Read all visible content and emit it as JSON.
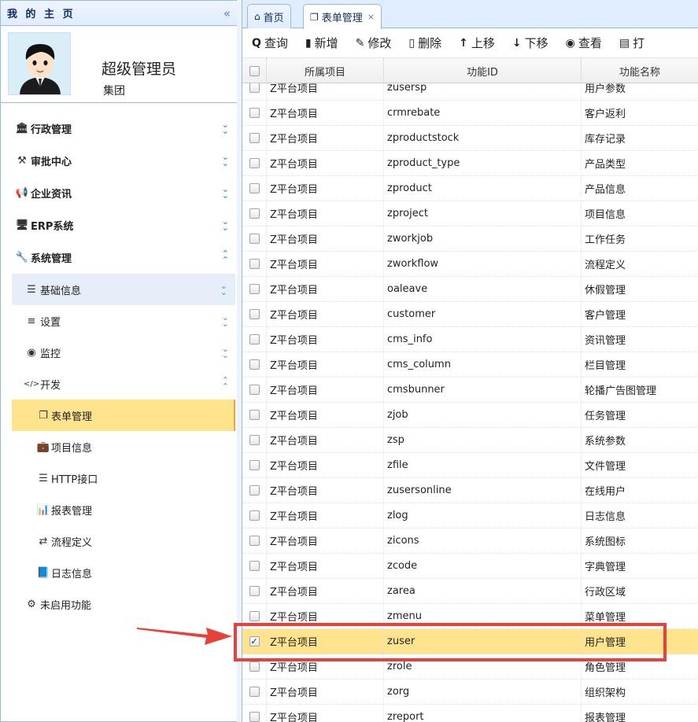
{
  "sidebar": {
    "title": "我 的 主 页",
    "collapse_icon": "double-chevron-left-icon",
    "profile": {
      "name": "超级管理员",
      "org": "集团"
    },
    "menus": [
      {
        "icon": "bank-icon",
        "glyph": "🏛",
        "label": "行政管理",
        "chevron": "expand"
      },
      {
        "icon": "gavel-icon",
        "glyph": "⚒",
        "label": "审批中心",
        "chevron": "expand"
      },
      {
        "icon": "bullhorn-icon",
        "glyph": "📢",
        "label": "企业资讯",
        "chevron": "expand"
      },
      {
        "icon": "monitor-icon",
        "glyph": "🖥",
        "label": "ERP系统",
        "chevron": "expand"
      },
      {
        "icon": "wrench-icon",
        "glyph": "🔧",
        "label": "系统管理",
        "chevron": "collapse"
      }
    ],
    "submenus": [
      {
        "icon": "bars-icon",
        "glyph": "☰",
        "label": "基础信息",
        "chevron": "expand",
        "highlight": true
      },
      {
        "icon": "sliders-icon",
        "glyph": "≡",
        "label": "设置",
        "chevron": "expand"
      },
      {
        "icon": "dashboard-icon",
        "glyph": "◉",
        "label": "监控",
        "chevron": "expand"
      },
      {
        "icon": "code-icon",
        "glyph": "</>",
        "label": "开发",
        "chevron": "collapse"
      }
    ],
    "leaves": [
      {
        "icon": "windows-restore-icon",
        "glyph": "❐",
        "label": "表单管理",
        "active": true
      },
      {
        "icon": "briefcase-icon",
        "glyph": "💼",
        "label": "项目信息"
      },
      {
        "icon": "server-icon",
        "glyph": "☰",
        "label": "HTTP接口"
      },
      {
        "icon": "bar-chart-icon",
        "glyph": "📊",
        "label": "报表管理"
      },
      {
        "icon": "usb-icon",
        "glyph": "⇄",
        "label": "流程定义"
      },
      {
        "icon": "book-icon",
        "glyph": "📘",
        "label": "日志信息"
      }
    ],
    "disabled": {
      "icon": "sitemap-icon",
      "glyph": "⚙",
      "label": "未启用功能"
    }
  },
  "tabs": [
    {
      "icon": "home-icon",
      "glyph": "⌂",
      "label": "首页"
    },
    {
      "icon": "windows-restore-icon",
      "glyph": "❐",
      "label": "表单管理",
      "close": "×",
      "active": true
    }
  ],
  "toolbar": [
    {
      "icon": "search-icon",
      "glyph": "🔍",
      "label": "查询"
    },
    {
      "icon": "file-icon",
      "glyph": "📄",
      "label": "新增"
    },
    {
      "icon": "edit-icon",
      "glyph": "✎",
      "label": "修改"
    },
    {
      "icon": "trash-icon",
      "glyph": "🗑",
      "label": "删除"
    },
    {
      "icon": "arrow-up-icon",
      "glyph": "↑",
      "label": "上移"
    },
    {
      "icon": "arrow-down-icon",
      "glyph": "↓",
      "label": "下移"
    },
    {
      "icon": "eye-icon",
      "glyph": "👁",
      "label": "查看"
    },
    {
      "icon": "print-icon",
      "glyph": "🖶",
      "label": "打"
    }
  ],
  "grid": {
    "columns": [
      "所属项目",
      "功能ID",
      "功能名称"
    ],
    "rows": [
      {
        "project": "Z平台项目",
        "id": "zusersp",
        "name": "用户参数"
      },
      {
        "project": "Z平台项目",
        "id": "crmrebate",
        "name": "客户返利"
      },
      {
        "project": "Z平台项目",
        "id": "zproductstock",
        "name": "库存记录"
      },
      {
        "project": "Z平台项目",
        "id": "zproduct_type",
        "name": "产品类型"
      },
      {
        "project": "Z平台项目",
        "id": "zproduct",
        "name": "产品信息"
      },
      {
        "project": "Z平台项目",
        "id": "zproject",
        "name": "项目信息"
      },
      {
        "project": "Z平台项目",
        "id": "zworkjob",
        "name": "工作任务"
      },
      {
        "project": "Z平台项目",
        "id": "zworkflow",
        "name": "流程定义"
      },
      {
        "project": "Z平台项目",
        "id": "oaleave",
        "name": "休假管理"
      },
      {
        "project": "Z平台项目",
        "id": "customer",
        "name": "客户管理"
      },
      {
        "project": "Z平台项目",
        "id": "cms_info",
        "name": "资讯管理"
      },
      {
        "project": "Z平台项目",
        "id": "cms_column",
        "name": "栏目管理"
      },
      {
        "project": "Z平台项目",
        "id": "cmsbunner",
        "name": "轮播广告图管理"
      },
      {
        "project": "Z平台项目",
        "id": "zjob",
        "name": "任务管理"
      },
      {
        "project": "Z平台项目",
        "id": "zsp",
        "name": "系统参数"
      },
      {
        "project": "Z平台项目",
        "id": "zfile",
        "name": "文件管理"
      },
      {
        "project": "Z平台项目",
        "id": "zusersonline",
        "name": "在线用户"
      },
      {
        "project": "Z平台项目",
        "id": "zlog",
        "name": "日志信息"
      },
      {
        "project": "Z平台项目",
        "id": "zicons",
        "name": "系统图标"
      },
      {
        "project": "Z平台项目",
        "id": "zcode",
        "name": "字典管理"
      },
      {
        "project": "Z平台项目",
        "id": "zarea",
        "name": "行政区域"
      },
      {
        "project": "Z平台项目",
        "id": "zmenu",
        "name": "菜单管理"
      },
      {
        "project": "Z平台项目",
        "id": "zuser",
        "name": "用户管理",
        "checked": true,
        "selected": true
      },
      {
        "project": "Z平台项目",
        "id": "zrole",
        "name": "角色管理"
      },
      {
        "project": "Z平台项目",
        "id": "zorg",
        "name": "组织架构"
      },
      {
        "project": "Z平台项目",
        "id": "zreport",
        "name": "报表管理"
      }
    ]
  },
  "colors": {
    "accent": "#95b8e7",
    "selected_row": "#ffe48d",
    "annotation": "#e8403a"
  }
}
